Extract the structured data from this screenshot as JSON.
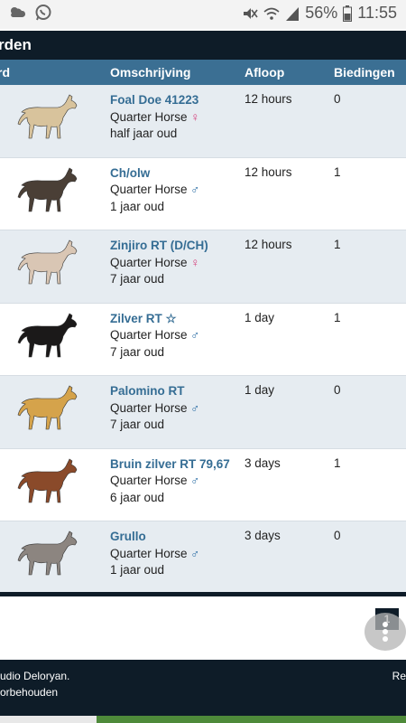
{
  "status_bar": {
    "battery_percent": "56%",
    "time": "11:55"
  },
  "page_title": "rden",
  "table": {
    "headers": {
      "horse": "rd",
      "description": "Omschrijving",
      "expiry": "Afloop",
      "bids": "Biedingen"
    },
    "rows": [
      {
        "name": "Foal Doe 41223",
        "breed": "Quarter Horse",
        "gender": "♀",
        "age": "half jaar oud",
        "expiry": "12 hours",
        "bids": "0",
        "coat": "#d8c39c"
      },
      {
        "name": "Ch/olw",
        "breed": "Quarter Horse",
        "gender": "♂",
        "age": "1 jaar oud",
        "expiry": "12 hours",
        "bids": "1",
        "coat": "#4a3f36"
      },
      {
        "name": "Zinjiro RT (D/CH)",
        "breed": "Quarter Horse",
        "gender": "♀",
        "age": "7 jaar oud",
        "expiry": "12 hours",
        "bids": "1",
        "coat": "#d9c6b4"
      },
      {
        "name": "Zilver RT ☆",
        "breed": "Quarter Horse",
        "gender": "♂",
        "age": "7 jaar oud",
        "expiry": "1 day",
        "bids": "1",
        "coat": "#1b1919"
      },
      {
        "name": "Palomino RT",
        "breed": "Quarter Horse",
        "gender": "♂",
        "age": "7 jaar oud",
        "expiry": "1 day",
        "bids": "0",
        "coat": "#d5a34b"
      },
      {
        "name": "Bruin zilver RT 79,67",
        "breed": "Quarter Horse",
        "gender": "♂",
        "age": "6 jaar oud",
        "expiry": "3 days",
        "bids": "1",
        "coat": "#8a4a2a"
      },
      {
        "name": "Grullo",
        "breed": "Quarter Horse",
        "gender": "♂",
        "age": "1 jaar oud",
        "expiry": "3 days",
        "bids": "0",
        "coat": "#8c8580"
      }
    ]
  },
  "pagination": {
    "current_page": "1"
  },
  "footer": {
    "line1_left": "udio Deloryan.",
    "line2_left": "orbehouden",
    "line1_right": "Re"
  },
  "colors": {
    "header_dark": "#0e1c28",
    "table_header": "#3b6f93",
    "link": "#356d94",
    "row_alt": "#e6ecf1"
  },
  "icons": [
    "weather-icon",
    "whatsapp-icon",
    "mute-icon",
    "wifi-icon",
    "signal-icon",
    "battery-icon",
    "horse-thumbnail",
    "female-icon",
    "male-icon",
    "more-options-icon"
  ]
}
